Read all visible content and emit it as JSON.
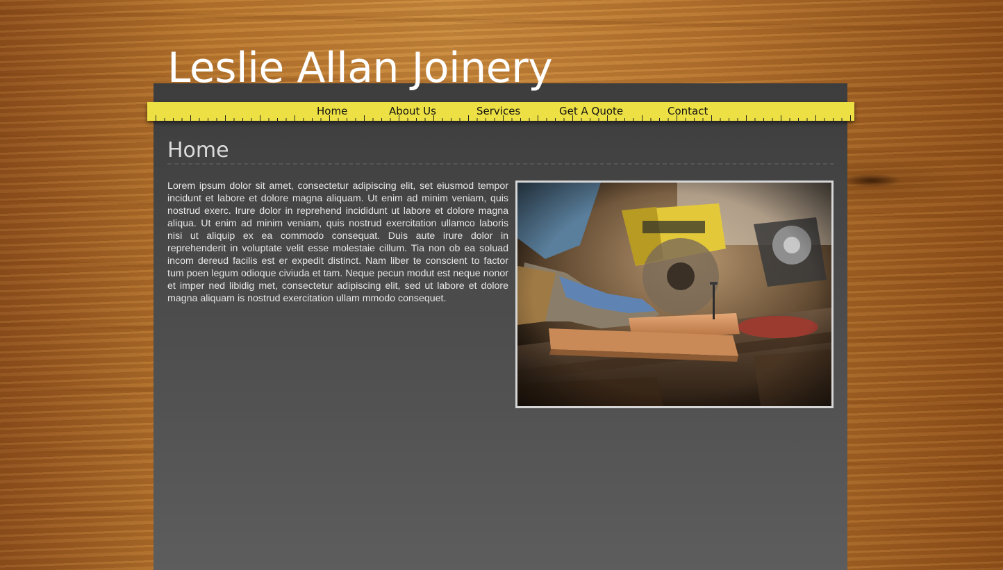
{
  "site": {
    "title": "Leslie Allan Joinery"
  },
  "nav": {
    "items": [
      {
        "label": "Home"
      },
      {
        "label": "About Us"
      },
      {
        "label": "Services"
      },
      {
        "label": "Get A Quote"
      },
      {
        "label": "Contact"
      }
    ]
  },
  "page": {
    "heading": "Home",
    "body": "Lorem ipsum dolor sit amet, consectetur adipiscing elit, set eiusmod tempor incidunt et labore et dolore magna aliquam. Ut enim ad minim veniam, quis nostrud exerc. Irure dolor in reprehend incididunt ut labore et dolore magna aliqua. Ut enim ad minim veniam, quis nostrud exercitation ullamco laboris nisi ut aliquip ex ea commodo consequat. Duis aute irure dolor in reprehenderit in voluptate velit esse molestaie cillum. Tia non ob ea soluad incom dereud facilis est er expedit distinct. Nam liber te conscient to factor tum poen legum odioque civiuda et tam. Neque pecun modut est neque nonor et imper ned libidig met, consectetur adipiscing elit, sed ut labore et dolore magna aliquam is nostrud exercitation ullam mmodo consequet."
  },
  "colors": {
    "nav_bar": "#ece044",
    "panel": "#4a4a4a",
    "title": "#ffffff",
    "heading": "#dcdcdc",
    "body_text": "#e6e6e6",
    "photo_border": "#d6d6d6"
  },
  "image": {
    "subject": "carpenter-workbench-photo"
  }
}
